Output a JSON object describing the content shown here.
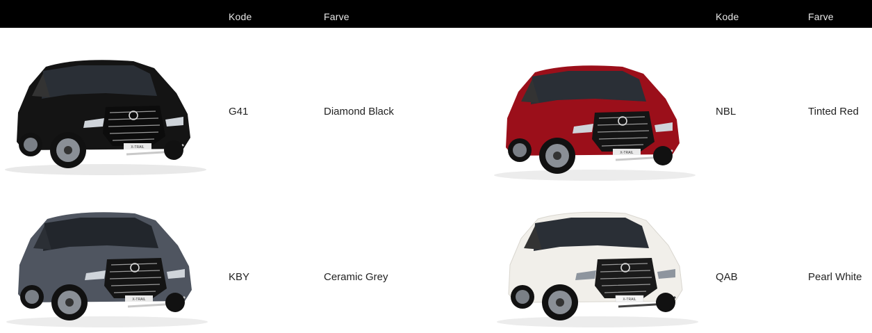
{
  "header": {
    "left_code_label": "Kode",
    "left_color_label": "Farve",
    "right_code_label": "Kode",
    "right_color_label": "Farve"
  },
  "colors": {
    "header_bg": "#000000",
    "car_black": "#141414",
    "car_red": "#9b0f1a",
    "car_grey": "#4f5560",
    "car_white": "#f1efea"
  },
  "cars": [
    {
      "code": "G41",
      "color_name": "Diamond Black",
      "badge": "X-TRAIL"
    },
    {
      "code": "NBL",
      "color_name": "Tinted Red",
      "badge": "X-TRAIL"
    },
    {
      "code": "KBY",
      "color_name": "Ceramic Grey",
      "badge": "X-TRAIL"
    },
    {
      "code": "QAB",
      "color_name": "Pearl White",
      "badge": "X-TRAIL"
    }
  ]
}
